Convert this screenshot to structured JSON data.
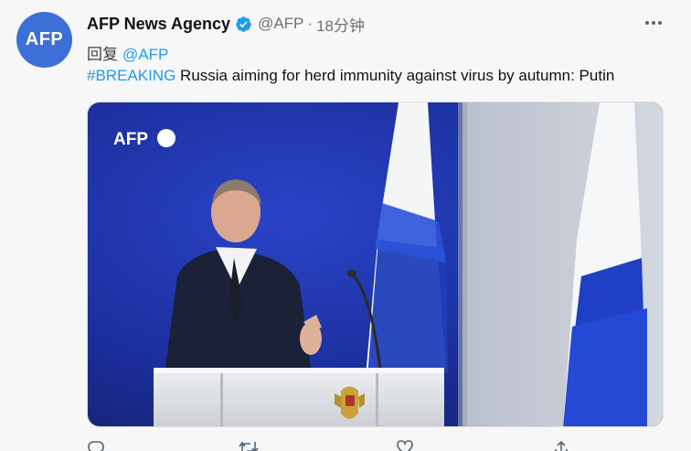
{
  "tweet": {
    "avatar_text": "AFP",
    "display_name": "AFP News Agency",
    "handle": "@AFP",
    "separator": "·",
    "time": "18分钟",
    "reply_prefix": "回复",
    "reply_mention": "@AFP",
    "hashtag": "#BREAKING",
    "text": " Russia aiming for herd immunity against virus by autumn: Putin"
  },
  "media": {
    "watermark": "AFP"
  },
  "colors": {
    "link": "#1d9bf0",
    "verified": "#1d9bf0",
    "avatar_bg": "#3d6fd8",
    "flag_blue": "#1e3fb8",
    "backdrop_blue": "#1b2f9e"
  },
  "icons": [
    "verified-badge-icon",
    "more-options-icon",
    "reply-icon",
    "retweet-icon",
    "like-icon",
    "share-icon"
  ]
}
